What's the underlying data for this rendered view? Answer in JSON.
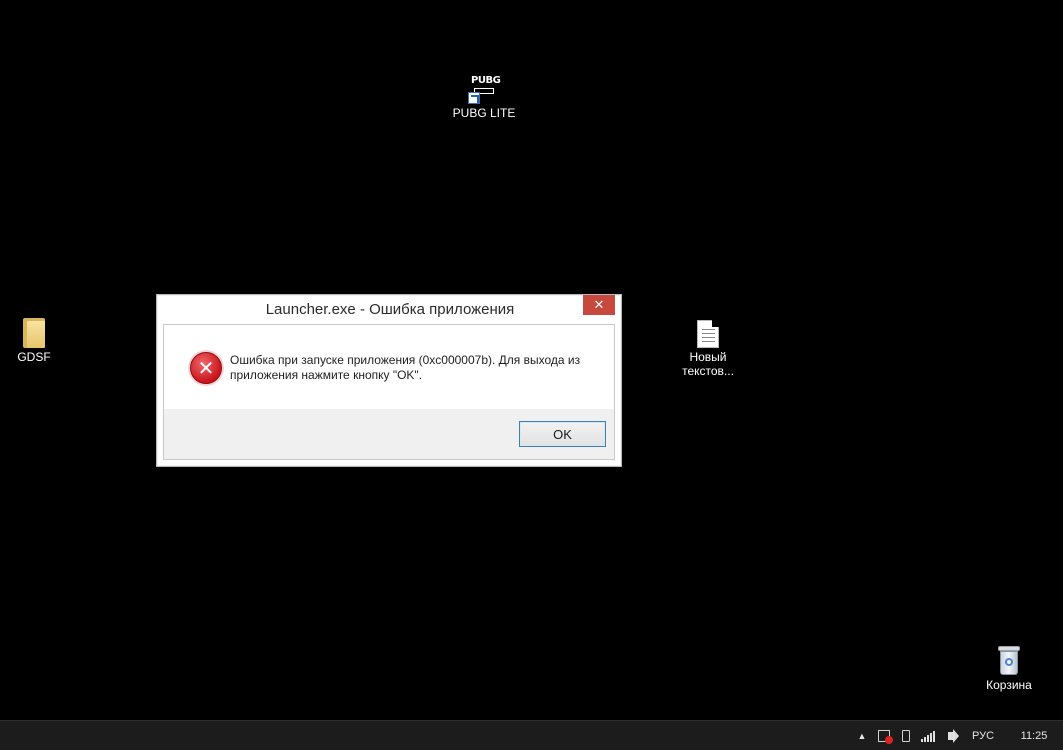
{
  "desktop": {
    "icons": [
      {
        "name": "pubg-lite",
        "label": "PUBG LITE",
        "glyph_text": "PUBG"
      },
      {
        "name": "gdsf-folder",
        "label": "GDSF"
      },
      {
        "name": "text-document",
        "label_line1": "Новый",
        "label_line2": "текстов..."
      },
      {
        "name": "recycle-bin",
        "label": "Корзина"
      }
    ]
  },
  "dialog": {
    "title": "Launcher.exe - Ошибка приложения",
    "close_glyph": "✕",
    "icon": "error-icon",
    "error_glyph": "✕",
    "message_line1": "Ошибка при запуске приложения (0xc000007b). Для выхода из",
    "message_line2": "приложения нажмите кнопку \"OK\".",
    "ok_label": "OK"
  },
  "taskbar": {
    "tray": {
      "chevron": "▲",
      "icons": [
        "action-center-flag-icon",
        "power-plug-icon",
        "network-signal-icon",
        "speaker-icon"
      ],
      "language": "РУС",
      "clock": "11:25"
    }
  },
  "colors": {
    "desktop_background": "#000000",
    "close_button": "#c7483c",
    "error_red": "#c8141c",
    "ok_button_border": "#3c7fb1",
    "taskbar": "#1c1c1c"
  }
}
